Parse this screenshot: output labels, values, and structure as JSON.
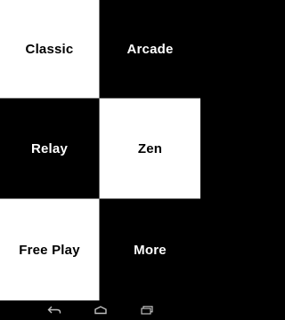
{
  "menu": {
    "tiles": [
      {
        "label": "Classic",
        "color": "white"
      },
      {
        "label": "Arcade",
        "color": "black"
      },
      {
        "label": "Relay",
        "color": "black"
      },
      {
        "label": "Zen",
        "color": "white"
      },
      {
        "label": "Free Play",
        "color": "white"
      },
      {
        "label": "More",
        "color": "black"
      }
    ]
  },
  "navbar": {
    "buttons": [
      "back-icon",
      "home-icon",
      "recent-apps-icon"
    ],
    "icon_color": "#bfbfbf"
  }
}
